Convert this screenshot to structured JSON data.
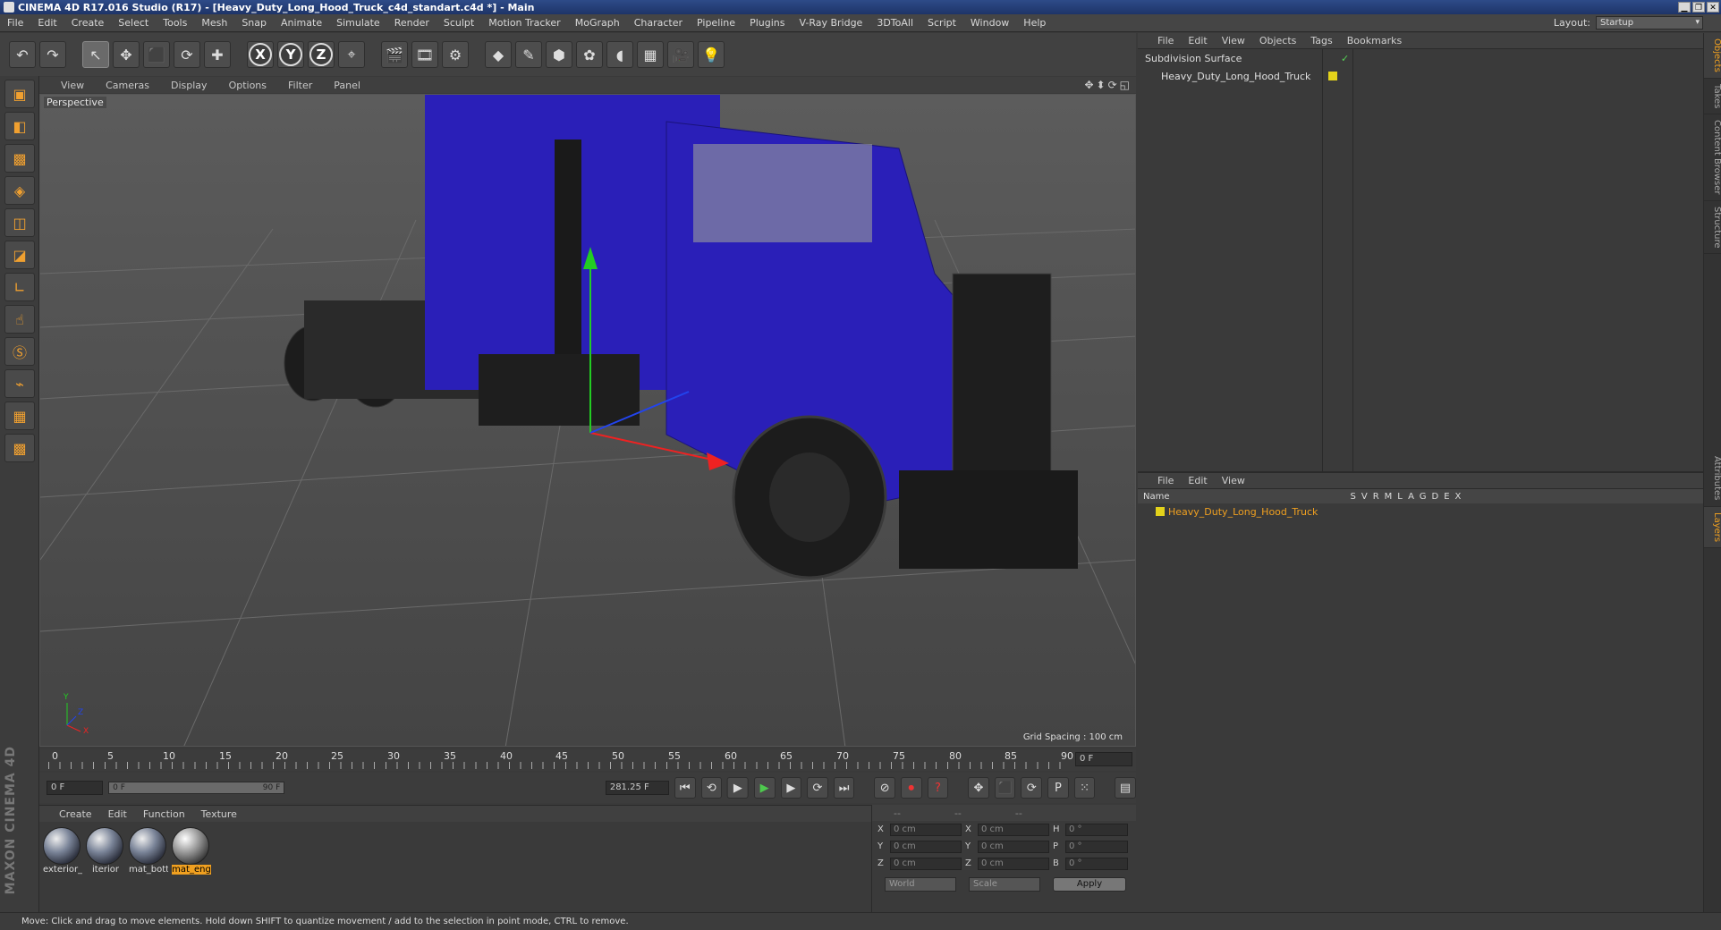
{
  "window": {
    "title": "CINEMA 4D R17.016 Studio (R17) - [Heavy_Duty_Long_Hood_Truck_c4d_standart.c4d *] - Main",
    "min": "▁",
    "max": "❐",
    "close": "✕"
  },
  "menubar": {
    "items": [
      "File",
      "Edit",
      "Create",
      "Select",
      "Tools",
      "Mesh",
      "Snap",
      "Animate",
      "Simulate",
      "Render",
      "Sculpt",
      "Motion Tracker",
      "MoGraph",
      "Character",
      "Pipeline",
      "Plugins",
      "V-Ray Bridge",
      "3DToAll",
      "Script",
      "Window",
      "Help"
    ],
    "layout_label": "Layout:",
    "layout_value": "Startup"
  },
  "toolbar": {
    "undo": "↶",
    "redo": "↷",
    "live_select": "↖",
    "move": "✥",
    "scale": "⬛",
    "rotate": "⟳",
    "add": "✚",
    "axis_x": "X",
    "axis_y": "Y",
    "axis_z": "Z",
    "world": "⌖",
    "render_view": "🎬",
    "render_pic": "🎞",
    "render_settings": "⚙",
    "cube": "◆",
    "pen": "✎",
    "nurbs": "⬢",
    "array": "✿",
    "deformer": "◖",
    "floor": "▦",
    "camera": "🎥",
    "light": "💡"
  },
  "lefttools": {
    "icons": [
      "▣",
      "◧",
      "▩",
      "◈",
      "◫",
      "◪",
      "∟",
      "☝",
      "Ⓢ",
      "⌁",
      "▦",
      "▩"
    ]
  },
  "viewport": {
    "menu": [
      "View",
      "Cameras",
      "Display",
      "Options",
      "Filter",
      "Panel"
    ],
    "nav_icons": "✥⬍⟳◱",
    "label": "Perspective",
    "grid_spacing": "Grid Spacing : 100 cm",
    "axis_x": "X",
    "axis_y": "Y",
    "axis_z": "Z"
  },
  "timeline": {
    "labels": [
      "0",
      "5",
      "10",
      "15",
      "20",
      "25",
      "30",
      "35",
      "40",
      "45",
      "50",
      "55",
      "60",
      "65",
      "70",
      "75",
      "80",
      "85",
      "90"
    ],
    "end_frame": "0 F"
  },
  "playbar": {
    "current_frame": "0 F",
    "range_start": "0 F",
    "range_end": "90 F",
    "fps_value": "281.25 F",
    "go_start": "⏮",
    "prev_key": "⟲",
    "prev_frame": "◀",
    "play": "▶",
    "next_frame": "▶",
    "next_key": "⟳",
    "go_end": "⏭",
    "record_auto": "⊘",
    "record": "⏺",
    "record_help": "?",
    "key_move": "✥",
    "key_scale": "⬛",
    "key_rotate": "⟳",
    "key_param": "P",
    "key_pla": "⁙",
    "timeline_btn": "▤"
  },
  "materials": {
    "menu": [
      "Create",
      "Edit",
      "Function",
      "Texture"
    ],
    "items": [
      {
        "name": "exterior_"
      },
      {
        "name": "iterior"
      },
      {
        "name": "mat_bott"
      },
      {
        "name": "mat_eng"
      }
    ]
  },
  "coords": {
    "head": [
      "--",
      "--",
      "--"
    ],
    "rows": [
      {
        "a": "X",
        "av": "0 cm",
        "b": "X",
        "bv": "0 cm",
        "c": "H",
        "cv": "0 °"
      },
      {
        "a": "Y",
        "av": "0 cm",
        "b": "Y",
        "bv": "0 cm",
        "c": "P",
        "cv": "0 °"
      },
      {
        "a": "Z",
        "av": "0 cm",
        "b": "Z",
        "bv": "0 cm",
        "c": "B",
        "cv": "0 °"
      }
    ],
    "mode_world": "World",
    "mode_scale": "Scale",
    "apply": "Apply"
  },
  "objects": {
    "menu": [
      "File",
      "Edit",
      "View",
      "Objects",
      "Tags",
      "Bookmarks"
    ],
    "rows": [
      {
        "name": "Subdivision Surface"
      },
      {
        "name": "Heavy_Duty_Long_Hood_Truck"
      }
    ],
    "check": "✓"
  },
  "layers": {
    "menu": [
      "File",
      "Edit",
      "View"
    ],
    "name_header": "Name",
    "cols": "SVRMLAGDEX",
    "rows": [
      {
        "name": "Heavy_Duty_Long_Hood_Truck"
      }
    ]
  },
  "side_tabs": [
    "Objects",
    "Takes",
    "Content Browser",
    "Structure",
    "Attributes",
    "Layers"
  ],
  "brand": "MAXON CINEMA 4D",
  "status": "Move: Click and drag to move elements. Hold down SHIFT to quantize movement / add to the selection in point mode, CTRL to remove.",
  "colors": {
    "accent": "#f0a020",
    "layer": "#e3d21b",
    "truck_body": "#2a1fb8"
  }
}
